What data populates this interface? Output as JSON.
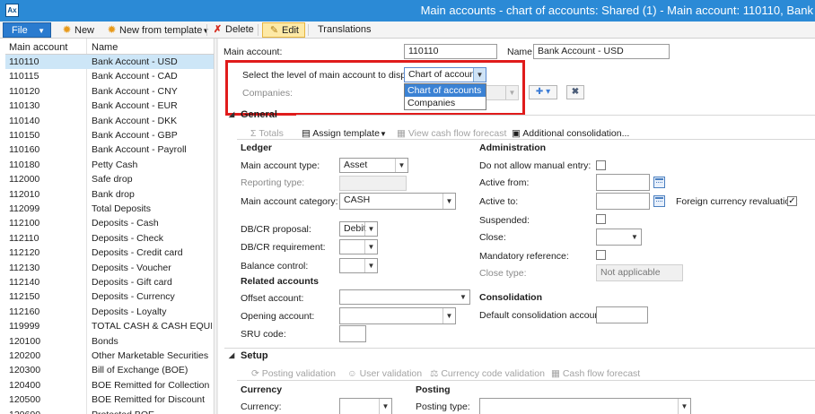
{
  "window": {
    "title": "Main accounts - chart of accounts: Shared (1) - Main account: 110110, Bank"
  },
  "actions": {
    "file": "File",
    "new": "New",
    "new_from_template": "New from template",
    "delete": "Delete",
    "edit": "Edit",
    "translations": "Translations"
  },
  "grid": {
    "columns": [
      "Main account",
      "Name"
    ],
    "rows": [
      [
        "110110",
        "Bank Account - USD"
      ],
      [
        "110115",
        "Bank Account - CAD"
      ],
      [
        "110120",
        "Bank Account - CNY"
      ],
      [
        "110130",
        "Bank Account - EUR"
      ],
      [
        "110140",
        "Bank Account - DKK"
      ],
      [
        "110150",
        "Bank Account - GBP"
      ],
      [
        "110160",
        "Bank Account - Payroll"
      ],
      [
        "110180",
        "Petty Cash"
      ],
      [
        "112000",
        "Safe drop"
      ],
      [
        "112010",
        "Bank drop"
      ],
      [
        "112099",
        "Total Deposits"
      ],
      [
        "112100",
        "Deposits - Cash"
      ],
      [
        "112110",
        "Deposits - Check"
      ],
      [
        "112120",
        "Deposits - Credit card"
      ],
      [
        "112130",
        "Deposits - Voucher"
      ],
      [
        "112140",
        "Deposits - Gift card"
      ],
      [
        "112150",
        "Deposits - Currency"
      ],
      [
        "112160",
        "Deposits - Loyalty"
      ],
      [
        "119999",
        "TOTAL CASH & CASH EQUIVA"
      ],
      [
        "120100",
        "Bonds"
      ],
      [
        "120200",
        "Other Marketable Securities"
      ],
      [
        "120300",
        "Bill of Exchange (BOE)"
      ],
      [
        "120400",
        "BOE Remitted for Collection"
      ],
      [
        "120500",
        "BOE Remitted for Discount"
      ],
      [
        "120600",
        "Protested BOE"
      ]
    ]
  },
  "header": {
    "main_account_label": "Main account:",
    "main_account_value": "110110",
    "name_label": "Name:",
    "name_value": "Bank Account - USD",
    "level_label": "Select the level of main account to display:",
    "level_value": "Chart of accounts",
    "level_options": [
      "Chart of accounts",
      "Companies"
    ],
    "companies_label": "Companies:"
  },
  "general": {
    "title": "General",
    "toolbar": {
      "totals": "Totals",
      "assign_template": "Assign template",
      "view_cash_flow": "View cash flow forecast",
      "additional_consolidation": "Additional consolidation..."
    },
    "ledger": {
      "title": "Ledger",
      "main_account_type_label": "Main account type:",
      "main_account_type_value": "Asset",
      "reporting_type_label": "Reporting type:",
      "main_account_category_label": "Main account category:",
      "main_account_category_value": "CASH",
      "dbcr_proposal_label": "DB/CR proposal:",
      "dbcr_proposal_value": "Debit",
      "dbcr_requirement_label": "DB/CR requirement:",
      "balance_control_label": "Balance control:"
    },
    "related": {
      "title": "Related accounts",
      "offset_account_label": "Offset account:",
      "opening_account_label": "Opening account:",
      "sru_code_label": "SRU code:"
    },
    "administration": {
      "title": "Administration",
      "no_manual_entry_label": "Do not allow manual entry:",
      "active_from_label": "Active from:",
      "active_to_label": "Active to:",
      "fx_revaluation_label": "Foreign currency revaluation:",
      "suspended_label": "Suspended:",
      "close_label": "Close:",
      "mandatory_reference_label": "Mandatory reference:",
      "close_type_label": "Close type:",
      "close_type_value": "Not applicable"
    },
    "consolidation": {
      "title": "Consolidation",
      "default_account_label": "Default consolidation account:"
    }
  },
  "setup": {
    "title": "Setup",
    "toolbar": {
      "posting_validation": "Posting validation",
      "user_validation": "User validation",
      "currency_code_validation": "Currency code validation",
      "cash_flow_forecast": "Cash flow forecast"
    },
    "currency_title": "Currency",
    "currency_label": "Currency:",
    "posting_title": "Posting",
    "posting_type_label": "Posting type:"
  }
}
